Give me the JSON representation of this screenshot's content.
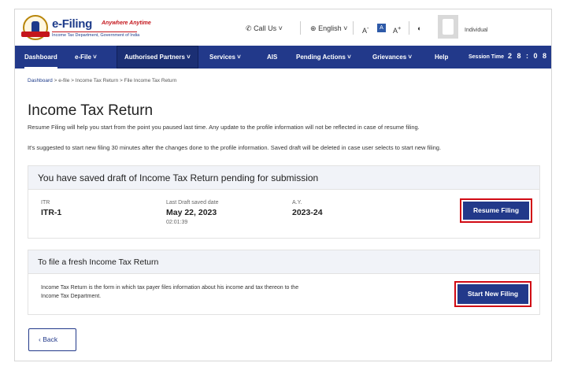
{
  "header": {
    "brand_title": "e-Filing",
    "brand_tagline": "Anywhere Anytime",
    "brand_subtitle": "Income Tax Department, Government of India",
    "call_us": "Call Us",
    "language": "English",
    "font_decrease": "A",
    "font_normal": "A",
    "font_increase": "A",
    "user_type": "Individual"
  },
  "nav": {
    "items": [
      {
        "label": "Dashboard"
      },
      {
        "label": "e-File"
      },
      {
        "label": "Authorised Partners"
      },
      {
        "label": "Services"
      },
      {
        "label": "AIS"
      },
      {
        "label": "Pending Actions"
      },
      {
        "label": "Grievances"
      },
      {
        "label": "Help"
      }
    ],
    "session_label": "Session Time",
    "session_time": "2 8 : 0 8"
  },
  "breadcrumb": {
    "items": [
      "Dashboard",
      "e-file",
      "Income Tax Return",
      "File Income Tax Return"
    ],
    "separator": ">"
  },
  "page": {
    "title": "Income Tax Return",
    "desc1": "Resume Filing will help you start from the point you paused last time. Any update to the profile information will not be reflected in case of resume filing.",
    "desc2": "It's suggested to start new filing 30 minutes after the changes done to the profile information. Saved draft will be deleted in case user selects to start new filing."
  },
  "draft_card": {
    "title": "You have saved draft of Income Tax Return pending for submission",
    "itr_label": "ITR",
    "itr_value": "ITR-1",
    "date_label": "Last Draft saved date",
    "date_value": "May 22, 2023",
    "time_value": "02:01:39",
    "ay_label": "A.Y.",
    "ay_value": "2023-24",
    "resume_button": "Resume Filing"
  },
  "fresh_card": {
    "title": "To file a fresh Income Tax Return",
    "desc": "Income Tax Return is the form in which tax payer files information about his income and tax thereon to the Income Tax Department.",
    "start_button": "Start New Filing"
  },
  "back_button": "Back",
  "colors": {
    "primary": "#22398a",
    "highlight": "#d10a14",
    "card_header": "#f1f3f8"
  }
}
